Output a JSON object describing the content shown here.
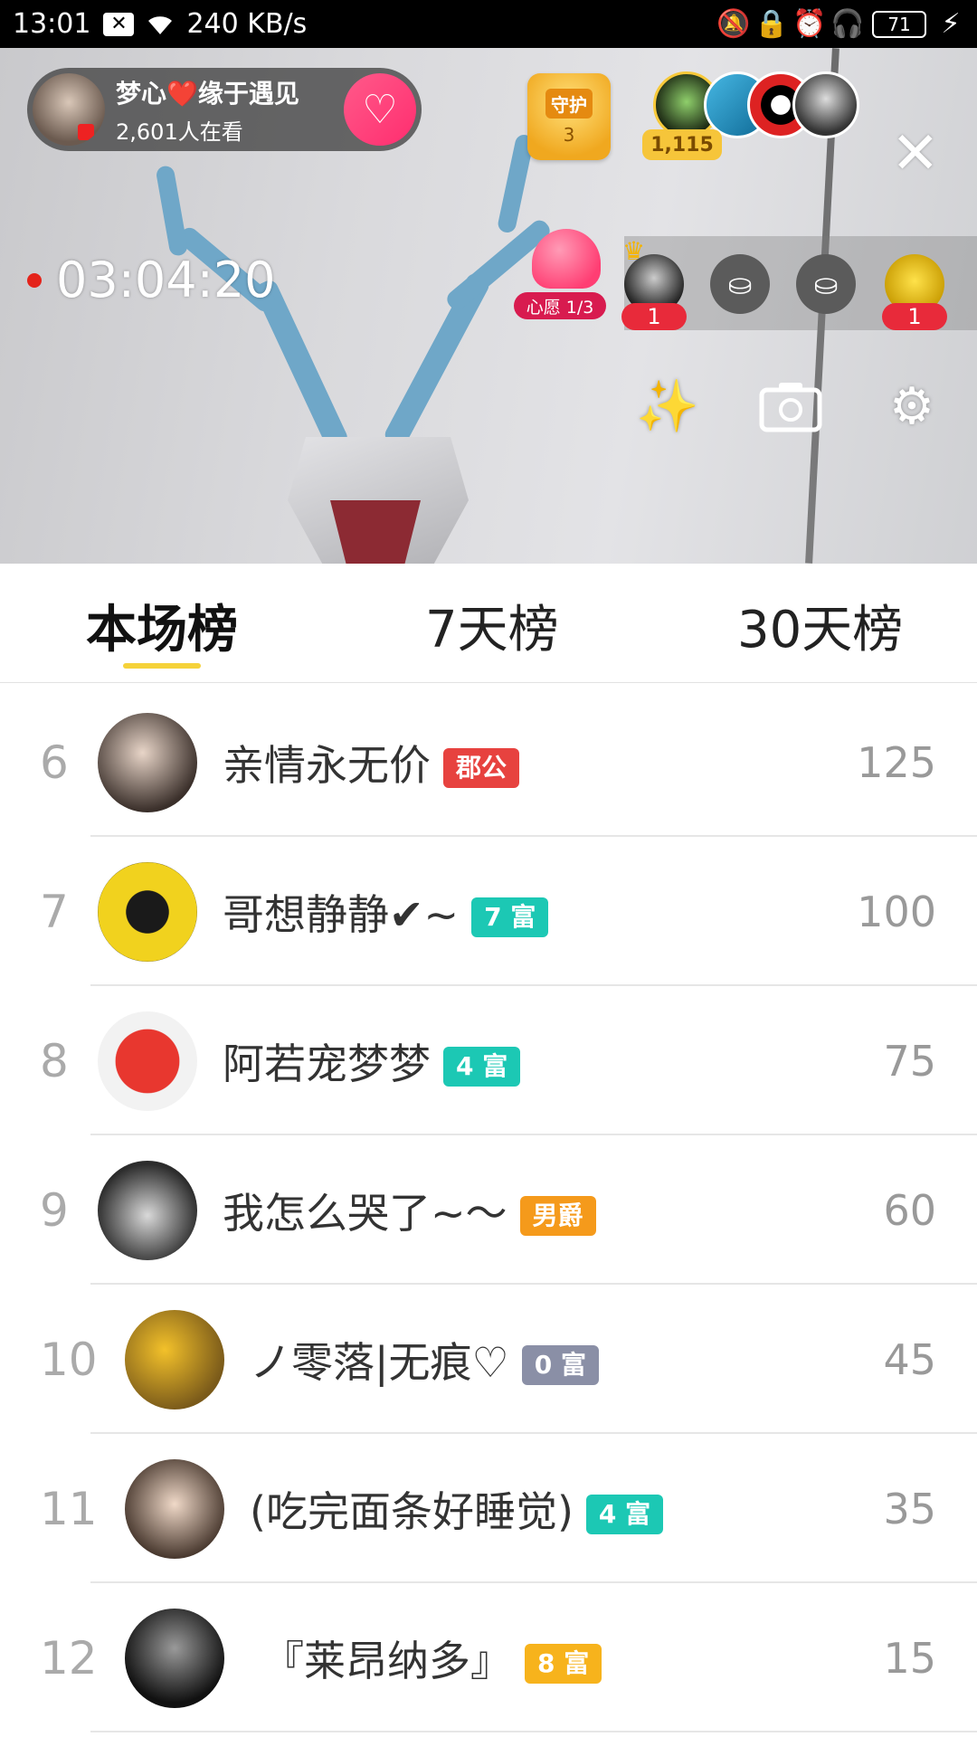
{
  "status_bar": {
    "time": "13:01",
    "speed": "240 KB/s",
    "battery": "71"
  },
  "host": {
    "name": "梦心❤️缘于遇见",
    "viewers": "2,601人在看"
  },
  "guard": {
    "label": "守护",
    "count": "3"
  },
  "top_viewers": {
    "coins": "1,115"
  },
  "timer": "03:04:20",
  "wish": {
    "label": "心愿 1/3"
  },
  "seats": {
    "count_1": "1",
    "count_4": "1"
  },
  "tabs": [
    {
      "label": "本场榜"
    },
    {
      "label": "7天榜"
    },
    {
      "label": "30天榜"
    }
  ],
  "ranking": [
    {
      "rank": "6",
      "name": "亲情永无价",
      "badge": "郡公",
      "badge_color": "#e7423f",
      "score": "125"
    },
    {
      "rank": "7",
      "name": "哥想静静✔~",
      "badge": "7 富",
      "badge_color": "#1cc8b4",
      "score": "100"
    },
    {
      "rank": "8",
      "name": "阿若宠梦梦",
      "badge": "4 富",
      "badge_color": "#1cc8b4",
      "score": "75"
    },
    {
      "rank": "9",
      "name": "我怎么哭了~〜",
      "badge": "男爵",
      "badge_color": "#f59a1b",
      "score": "60"
    },
    {
      "rank": "10",
      "name": "ノ零落|无痕♡",
      "badge": "0 富",
      "badge_color": "#8a8fa6",
      "score": "45"
    },
    {
      "rank": "11",
      "name": "(吃完面条好睡觉)",
      "badge": "4 富",
      "badge_color": "#1cc8b4",
      "score": "35"
    },
    {
      "rank": "12",
      "name": "『莱昂纳多』",
      "badge": "8 富",
      "badge_color": "#f7b31c",
      "score": "15"
    }
  ],
  "colors": {
    "accent_yellow": "#f5d23a",
    "live_red": "#e4231a",
    "follow_pink": "#ff3e73"
  },
  "icons": {
    "follow": "heart-plus-icon",
    "close": "close-icon",
    "beauty": "magic-wand-icon",
    "camera": "camera-switch-icon",
    "settings": "gear-icon"
  }
}
